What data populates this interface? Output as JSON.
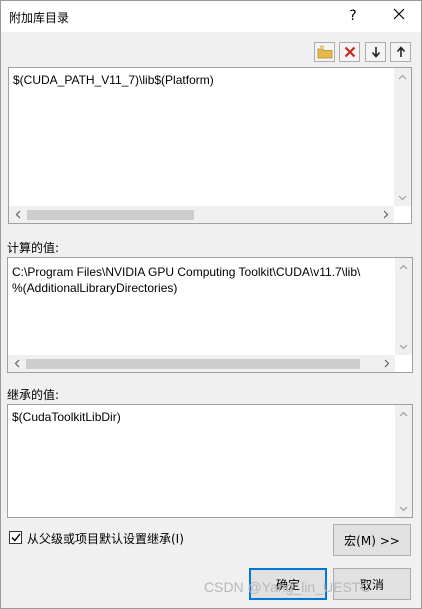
{
  "window": {
    "title": "附加库目录",
    "help_glyph": "?",
    "close_glyph": "✕"
  },
  "editor": {
    "lines": [
      "$(CUDA_PATH_V11_7)\\lib$(Platform)"
    ]
  },
  "computed": {
    "label": "计算的值:",
    "lines": [
      "C:\\Program Files\\NVIDIA GPU Computing Toolkit\\CUDA\\v11.7\\lib\\",
      "%(AdditionalLibraryDirectories)"
    ]
  },
  "inherited": {
    "label": "继承的值:",
    "lines": [
      "$(CudaToolkitLibDir)"
    ]
  },
  "options": {
    "inherit_label": "从父级或项目默认设置继承(I)",
    "inherit_checked": true
  },
  "buttons": {
    "macros": "宏(M) >>",
    "ok": "确定",
    "cancel": "取消"
  },
  "watermark": "CSDN @Yang_lin_UESTC",
  "colors": {
    "delete_icon": "#c42b1c",
    "new_folder_icon": "#e8b84a",
    "default_button_border": "#0078d7"
  }
}
